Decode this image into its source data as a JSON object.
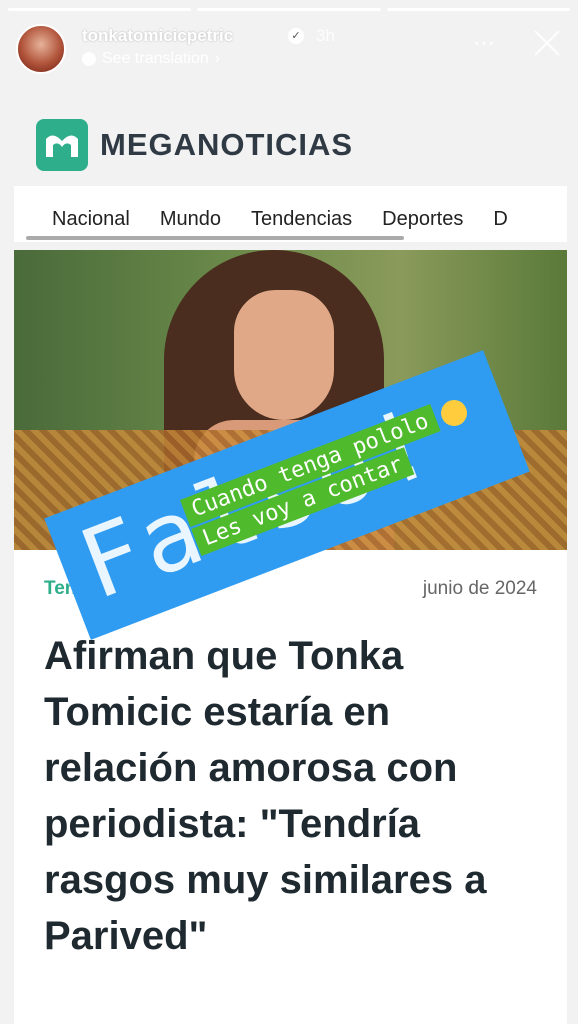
{
  "story": {
    "username": "tonkatomicicpetric",
    "time": "3h",
    "translate_label": "See translation",
    "more_label": "⋯"
  },
  "site": {
    "logo_text": "MEGANOTICIAS",
    "nav": [
      "Nacional",
      "Mundo",
      "Tendencias",
      "Deportes",
      "D"
    ],
    "category": "Tend",
    "date": "junio de 2024",
    "headline": "Afirman que Tonka Tomicic estaría en relación amorosa con periodista: \"Tendría rasgos muy similares a Parived\""
  },
  "stickers": {
    "main": "Falso!",
    "line1": "Cuando tenga pololo",
    "line2": "Les voy a contar"
  },
  "colors": {
    "accent": "#2eae8b",
    "sticker_blue": "#2f9cf2",
    "sticker_green": "#4fba2c"
  }
}
